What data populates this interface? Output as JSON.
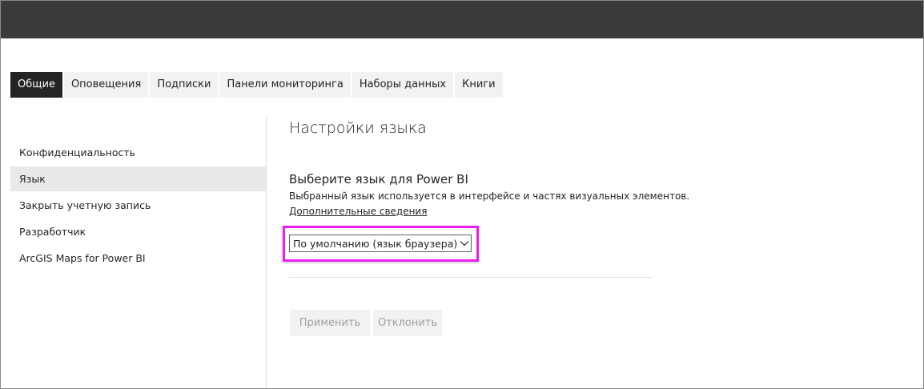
{
  "colors": {
    "topbar": "#3b3a39",
    "active_tab": "#252423",
    "highlight": "#ee1ef2",
    "selected_sidebar": "#e9e9e9",
    "disabled_text": "#a19f9d"
  },
  "tabs": [
    {
      "label": "Общие",
      "active": true
    },
    {
      "label": "Оповещения",
      "active": false
    },
    {
      "label": "Подписки",
      "active": false
    },
    {
      "label": "Панели мониторинга",
      "active": false
    },
    {
      "label": "Наборы данных",
      "active": false
    },
    {
      "label": "Книги",
      "active": false
    }
  ],
  "sidebar": {
    "items": [
      {
        "label": "Конфиденциальность",
        "selected": false
      },
      {
        "label": "Язык",
        "selected": true
      },
      {
        "label": "Закрыть учетную запись",
        "selected": false
      },
      {
        "label": "Разработчик",
        "selected": false
      },
      {
        "label": "ArcGIS Maps for Power BI",
        "selected": false
      }
    ]
  },
  "main": {
    "title": "Настройки языка",
    "section_title": "Выберите язык для Power BI",
    "description": "Выбранный язык используется в интерфейсе и частях визуальных элементов.",
    "learn_more": "Дополнительные сведения",
    "language_select": {
      "value": "По умолчанию (язык браузера)",
      "icon": "chevron-down-icon"
    },
    "buttons": {
      "apply": "Применить",
      "discard": "Отклонить"
    }
  }
}
